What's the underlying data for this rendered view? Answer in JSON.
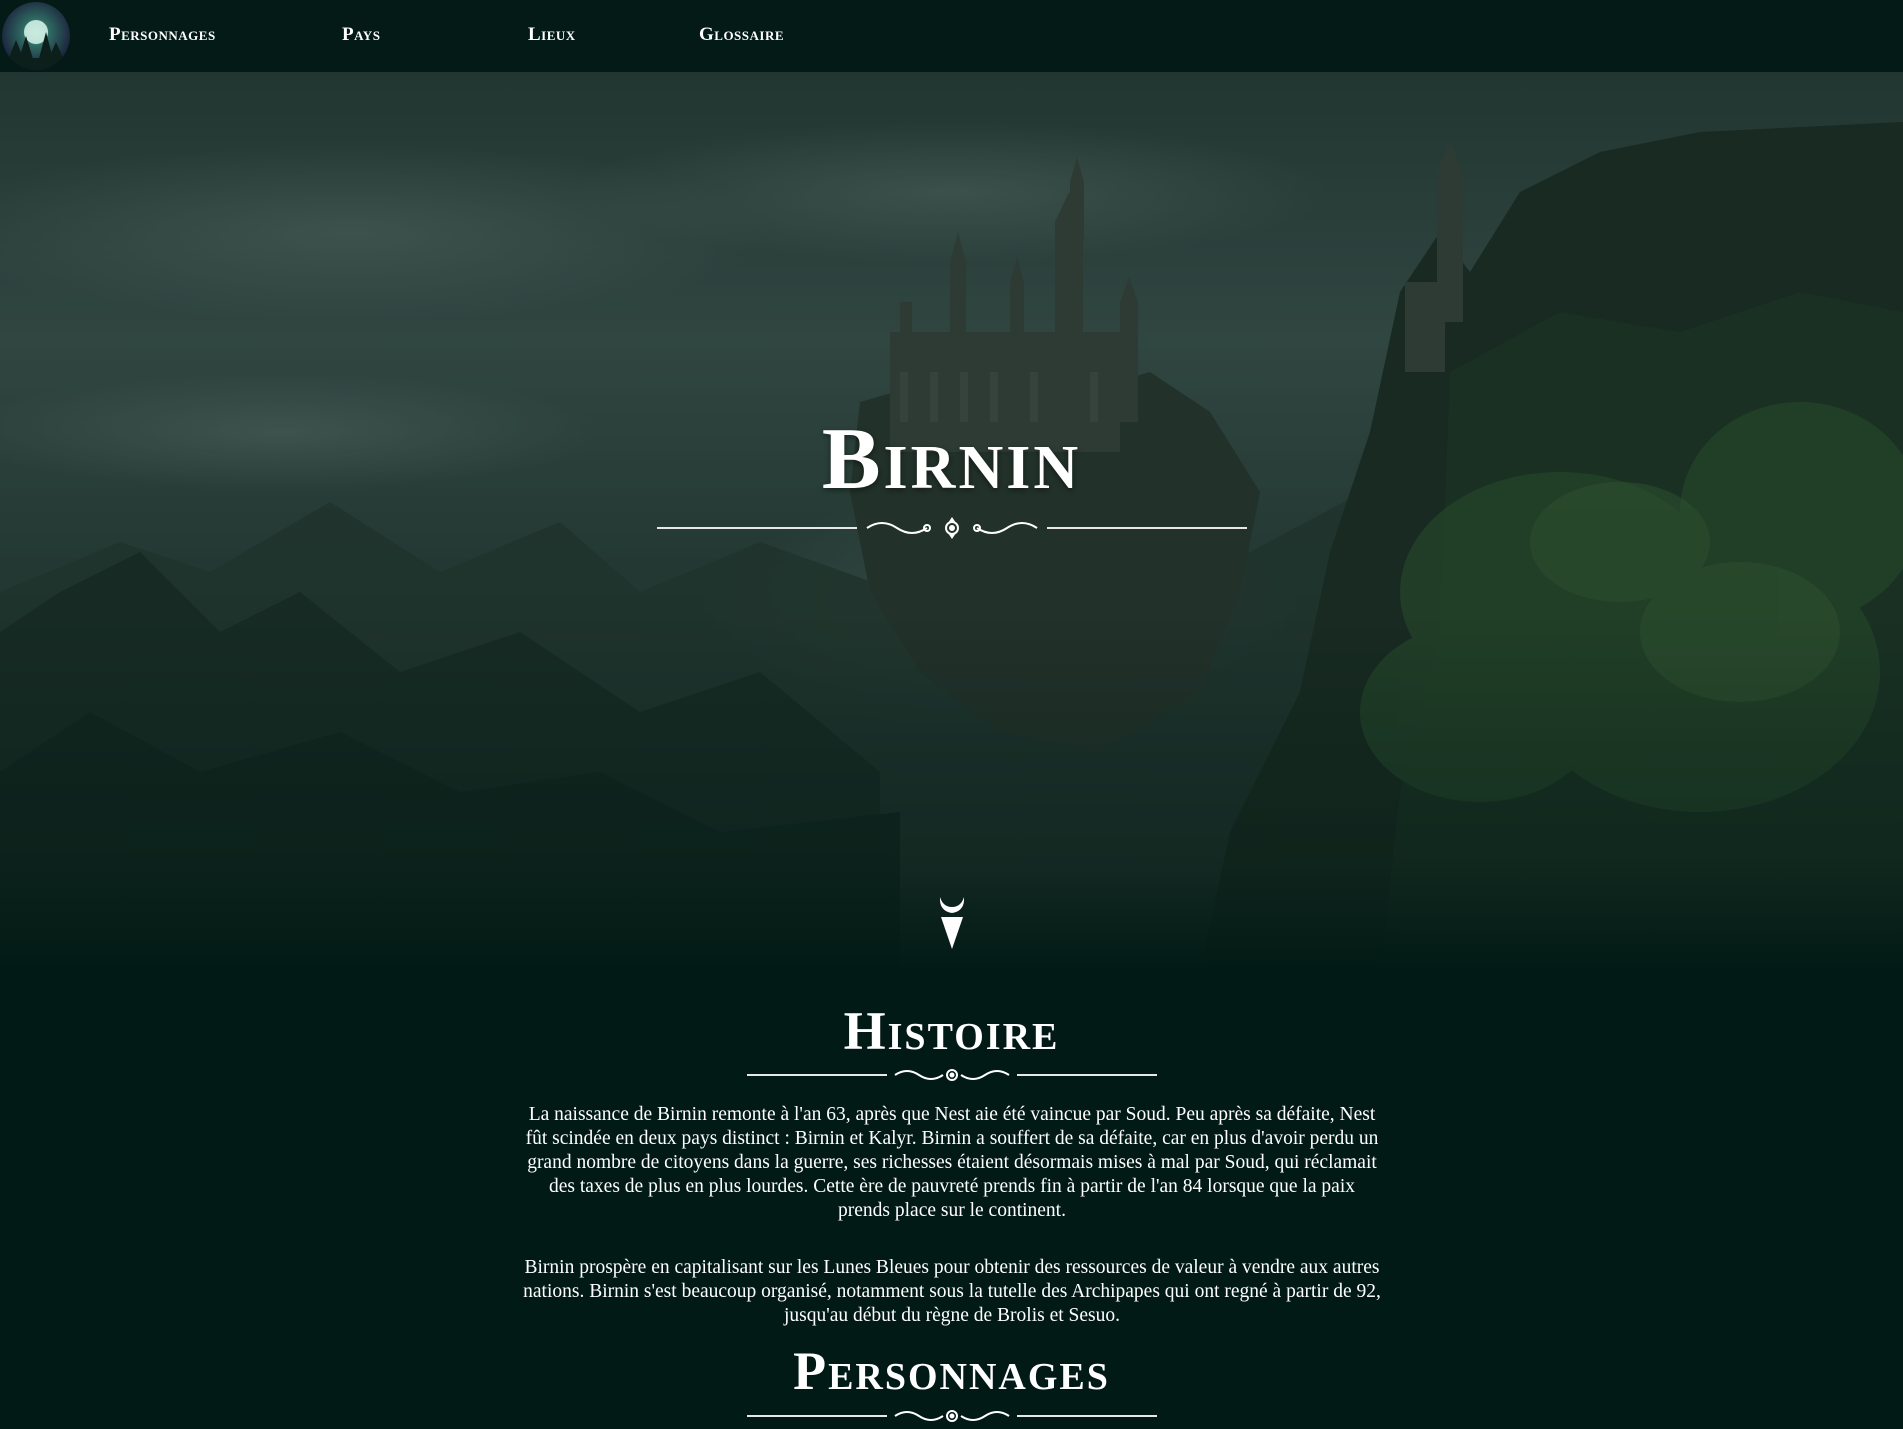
{
  "nav": {
    "logo_icon": "forest-moon-logo",
    "items": [
      {
        "label": "Personnages"
      },
      {
        "label": "Pays"
      },
      {
        "label": "Lieux"
      },
      {
        "label": "Glossaire"
      }
    ]
  },
  "hero": {
    "title": "Birnin",
    "background": "dark fantasy castle on cliff, misty mountains"
  },
  "emblem_icon": "crescent-blade-emblem",
  "histoire": {
    "title": "Histoire",
    "paragraphs": [
      "La naissance de Birnin remonte à l'an 63, après que Nest aie été vaincue par Soud. Peu après sa défaite, Nest fût scindée en deux pays distinct : Birnin et Kalyr. Birnin a souffert de sa défaite, car en plus d'avoir perdu un grand nombre de citoyens dans la guerre, ses richesses étaient désormais mises à mal par Soud, qui réclamait des taxes de plus en plus lourdes. Cette ère de pauvreté prends fin à partir de l'an 84 lorsque que la paix prends place sur le continent.",
      "Birnin prospère en capitalisant sur les Lunes Bleues pour obtenir des ressources de valeur à vendre aux autres nations. Birnin s'est beaucoup organisé, notamment sous la tutelle des Archipapes qui ont regné à partir de 92, jusqu'au début du règne de Brolis et Sesuo."
    ]
  },
  "personnages": {
    "title": "Personnages"
  },
  "colors": {
    "background": "#021a15",
    "nav": "#031a16",
    "text": "#ffffff"
  }
}
